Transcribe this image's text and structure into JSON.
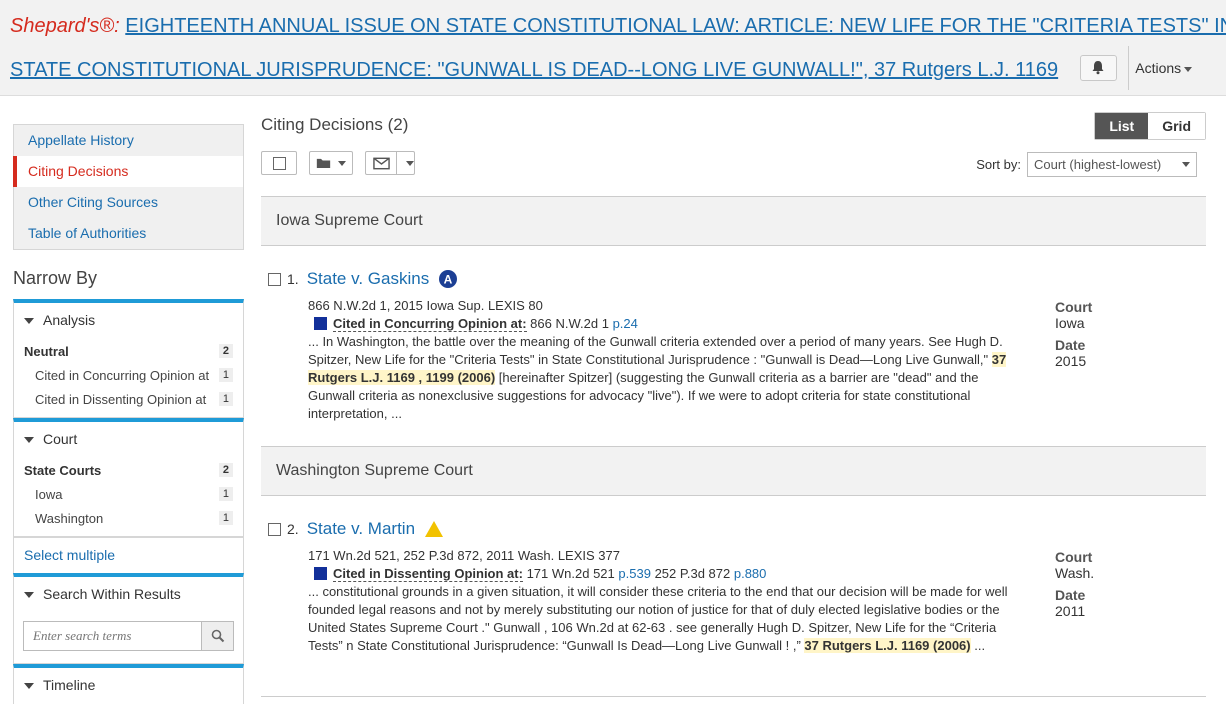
{
  "header": {
    "brand": "Shepard's®:",
    "title_line1": "EIGHTEENTH ANNUAL ISSUE ON STATE CONSTITUTIONAL LAW: ARTICLE: NEW LIFE FOR THE \"CRITERIA TESTS\" IN",
    "title_line2": "STATE CONSTITUTIONAL JURISPRUDENCE: \"GUNWALL IS DEAD--LONG LIVE GUNWALL!\", 37 Rutgers L.J. 1169",
    "actions_label": "Actions"
  },
  "sidebar": {
    "tabs": [
      {
        "label": "Appellate History"
      },
      {
        "label": "Citing Decisions"
      },
      {
        "label": "Other Citing Sources"
      },
      {
        "label": "Table of Authorities"
      }
    ],
    "narrow_title": "Narrow By",
    "analysis": {
      "heading": "Analysis",
      "group": "Neutral",
      "group_count": "2",
      "items": [
        {
          "label": "Cited in Concurring Opinion at",
          "count": "1"
        },
        {
          "label": "Cited in Dissenting Opinion at",
          "count": "1"
        }
      ]
    },
    "court": {
      "heading": "Court",
      "group": "State Courts",
      "group_count": "2",
      "items": [
        {
          "label": "Iowa",
          "count": "1"
        },
        {
          "label": "Washington",
          "count": "1"
        }
      ]
    },
    "select_multiple": "Select multiple",
    "search": {
      "heading": "Search Within Results",
      "placeholder": "Enter search terms"
    },
    "timeline": {
      "heading": "Timeline"
    }
  },
  "main": {
    "title": "Citing Decisions (2)",
    "view_list": "List",
    "view_grid": "Grid",
    "sort_label": "Sort by:",
    "sort_value": "Court (highest-lowest)",
    "groups": [
      {
        "court": "Iowa Supreme Court",
        "result": {
          "number": "1.",
          "name": "State v. Gaskins",
          "citation": "866 N.W.2d 1, 2015 Iowa Sup. LEXIS 80",
          "treatment": "Cited in Concurring Opinion at:",
          "pin_text": "866 N.W.2d 1",
          "pin_link": "p.24",
          "snippet_a": "... In Washington, the battle over the meaning of the Gunwall criteria extended over a period of many years. See Hugh D. Spitzer, New Life for the \"Criteria Tests\" in State Constitutional Jurisprudence : \"Gunwall is Dead—Long Live Gunwall,\" ",
          "snippet_hl": "37 Rutgers L.J. 1169 , 1199 (2006)",
          "snippet_b": " [hereinafter Spitzer] (suggesting the Gunwall criteria as a barrier are \"dead\" and the Gunwall criteria as nonexclusive suggestions for advocacy \"live\"). If we were to adopt criteria for state constitutional interpretation, ...",
          "court_label": "Court",
          "court_value": "Iowa",
          "date_label": "Date",
          "date_value": "2015"
        }
      },
      {
        "court": "Washington Supreme Court",
        "result": {
          "number": "2.",
          "name": "State v. Martin",
          "citation": "171 Wn.2d 521, 252 P.3d 872, 2011 Wash. LEXIS 377",
          "treatment": "Cited in Dissenting Opinion at:",
          "pin_text": "171 Wn.2d 521",
          "pin_link": "p.539",
          "pin_text2": "252 P.3d 872",
          "pin_link2": "p.880",
          "snippet_a": "... constitutional grounds in a given situation, it will consider these criteria to the end that our decision will be made for well founded legal reasons and not by merely substituting our notion of justice for that of duly elected legislative bodies or the United States Supreme Court .\" Gunwall , 106 Wn.2d at 62-63 . see generally Hugh D. Spitzer, New Life for the “Criteria Tests” n State Constitutional Jurisprudence: “Gunwall Is Dead—Long Live Gunwall ! ,” ",
          "snippet_hl": "37 Rutgers L.J. 1169 (2006)",
          "snippet_b": " ...",
          "court_label": "Court",
          "court_value": "Wash.",
          "date_label": "Date",
          "date_value": "2011"
        }
      }
    ]
  },
  "colors": {
    "brand": "#d52b1e",
    "link": "#1a6dae",
    "facet_accent": "#1f9bd7",
    "treatment_blue": "#12309a",
    "caution_yellow": "#f2c200"
  }
}
